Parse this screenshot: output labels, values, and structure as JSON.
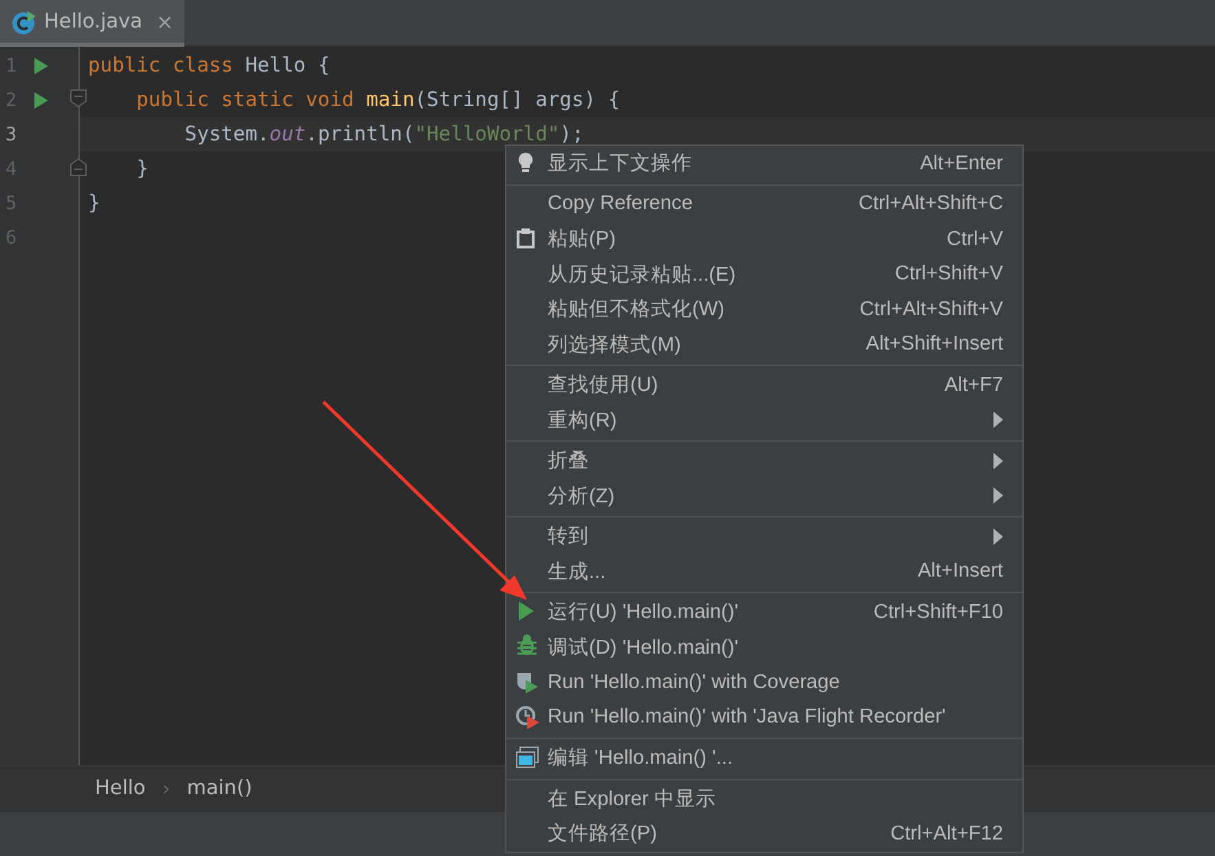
{
  "tabs": [
    {
      "label": "Hello.java",
      "selected": true,
      "close": "×"
    }
  ],
  "editor": {
    "lines": [
      {
        "number": "1",
        "current": false,
        "run": true,
        "fold_start": false,
        "fold_end": false,
        "tokens": [
          {
            "kind": "keyword",
            "text": "public class "
          },
          {
            "kind": "plain",
            "text": "Hello {"
          }
        ]
      },
      {
        "number": "2",
        "current": false,
        "run": true,
        "fold_start": true,
        "fold_end": false,
        "tokens": [
          {
            "kind": "keyword",
            "text": "    public static void "
          },
          {
            "kind": "method",
            "text": "main"
          },
          {
            "kind": "plain",
            "text": "(String[] args) {"
          }
        ]
      },
      {
        "number": "3",
        "current": true,
        "run": false,
        "fold_start": false,
        "fold_end": false,
        "tokens": [
          {
            "kind": "plain",
            "text": "        System."
          },
          {
            "kind": "field",
            "text": "out"
          },
          {
            "kind": "plain",
            "text": ".println("
          },
          {
            "kind": "string",
            "text": "\"HelloWorld\""
          },
          {
            "kind": "plain",
            "text": ");"
          }
        ]
      },
      {
        "number": "4",
        "current": false,
        "run": false,
        "fold_start": false,
        "fold_end": true,
        "tokens": [
          {
            "kind": "plain",
            "text": "    }"
          }
        ]
      },
      {
        "number": "5",
        "current": false,
        "run": false,
        "fold_start": false,
        "fold_end": false,
        "tokens": [
          {
            "kind": "plain",
            "text": "}"
          }
        ]
      },
      {
        "number": "6",
        "current": false,
        "run": false,
        "fold_start": false,
        "fold_end": false
      }
    ]
  },
  "breadcrumbs": {
    "items": [
      "Hello",
      "main()"
    ],
    "separator": "›"
  },
  "context_menu": {
    "items": [
      {
        "kind": "lightbulb",
        "label": "显示上下文操作",
        "shortcut": "Alt+Enter"
      },
      {
        "kind": "separator"
      },
      {
        "kind": "plain",
        "label": "Copy Reference",
        "shortcut": "Ctrl+Alt+Shift+C"
      },
      {
        "kind": "clipboard",
        "label": "粘贴(P)",
        "shortcut": "Ctrl+V"
      },
      {
        "kind": "plain",
        "label": "从历史记录粘贴...(E)",
        "shortcut": "Ctrl+Shift+V"
      },
      {
        "kind": "plain",
        "label": "粘贴但不格式化(W)",
        "shortcut": "Ctrl+Alt+Shift+V"
      },
      {
        "kind": "plain",
        "label": "列选择模式(M)",
        "shortcut": "Alt+Shift+Insert"
      },
      {
        "kind": "separator"
      },
      {
        "kind": "plain",
        "label": "查找使用(U)",
        "shortcut": "Alt+F7"
      },
      {
        "kind": "plain",
        "label": "重构(R)",
        "submenu": true
      },
      {
        "kind": "separator"
      },
      {
        "kind": "plain",
        "label": "折叠",
        "submenu": true
      },
      {
        "kind": "plain",
        "label": "分析(Z)",
        "submenu": true
      },
      {
        "kind": "separator"
      },
      {
        "kind": "plain",
        "label": "转到",
        "submenu": true
      },
      {
        "kind": "plain",
        "label": "生成...",
        "shortcut": "Alt+Insert"
      },
      {
        "kind": "separator"
      },
      {
        "kind": "run",
        "label": "运行(U) 'Hello.main()'",
        "shortcut": "Ctrl+Shift+F10"
      },
      {
        "kind": "debug",
        "label": "调试(D) 'Hello.main()'"
      },
      {
        "kind": "coverage",
        "label": "Run 'Hello.main()' with Coverage"
      },
      {
        "kind": "profiler",
        "label": "Run 'Hello.main()' with 'Java Flight Recorder'"
      },
      {
        "kind": "separator"
      },
      {
        "kind": "config",
        "label": "编辑 'Hello.main() '..."
      },
      {
        "kind": "separator"
      },
      {
        "kind": "plain",
        "label": "在 Explorer 中显示"
      },
      {
        "kind": "plain",
        "label": "文件路径(P)",
        "shortcut": "Ctrl+Alt+F12"
      }
    ]
  }
}
